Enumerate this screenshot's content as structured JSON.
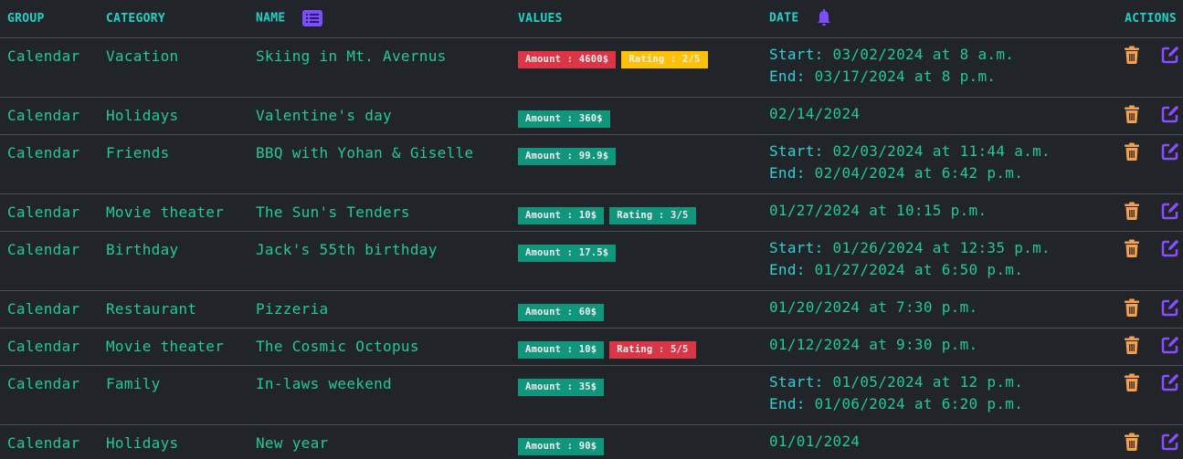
{
  "colors": {
    "background": "#212529",
    "header_text": "#20d3c9",
    "cell_text": "#20c997",
    "divider": "#4d5154",
    "badge_success": "#0f967c",
    "badge_danger": "#dc3545",
    "badge_warning": "#ffc107",
    "trash_icon": "#f5a04a",
    "edit_icon": "#8a4dff",
    "header_icon": "#7c4dff"
  },
  "header": {
    "group": "GROUP",
    "category": "CATEGORY",
    "name": "NAME",
    "name_icon": "list-icon",
    "values": "VALUES",
    "date": "DATE",
    "date_icon": "bell-icon",
    "actions": "ACTIONS"
  },
  "actions": {
    "delete_icon": "trash-icon",
    "edit_icon": "edit-icon"
  },
  "rows": [
    {
      "group": "Calendar",
      "category": "Vacation",
      "name": "Skiing in Mt. Avernus",
      "badges": [
        {
          "text": "Amount : 4600$",
          "variant": "danger"
        },
        {
          "text": "Rating : 2/5",
          "variant": "warning"
        }
      ],
      "date": {
        "start_label": "Start:",
        "start": "03/02/2024 at 8 a.m.",
        "end_label": "End:",
        "end": "03/17/2024 at 8 p.m."
      }
    },
    {
      "group": "Calendar",
      "category": "Holidays",
      "name": "Valentine's day",
      "badges": [
        {
          "text": "Amount : 360$",
          "variant": "success"
        }
      ],
      "date": {
        "single": "02/14/2024"
      }
    },
    {
      "group": "Calendar",
      "category": "Friends",
      "name": "BBQ with Yohan & Giselle",
      "badges": [
        {
          "text": "Amount : 99.9$",
          "variant": "success"
        }
      ],
      "date": {
        "start_label": "Start:",
        "start": "02/03/2024 at 11:44 a.m.",
        "end_label": "End:",
        "end": "02/04/2024 at 6:42 p.m."
      }
    },
    {
      "group": "Calendar",
      "category": "Movie theater",
      "name": "The Sun's Tenders",
      "badges": [
        {
          "text": "Amount : 10$",
          "variant": "success"
        },
        {
          "text": "Rating : 3/5",
          "variant": "success"
        }
      ],
      "date": {
        "single": "01/27/2024 at 10:15 p.m."
      }
    },
    {
      "group": "Calendar",
      "category": "Birthday",
      "name": "Jack's 55th birthday",
      "badges": [
        {
          "text": "Amount : 17.5$",
          "variant": "success"
        }
      ],
      "date": {
        "start_label": "Start:",
        "start": "01/26/2024 at 12:35 p.m.",
        "end_label": "End:",
        "end": "01/27/2024 at 6:50 p.m."
      }
    },
    {
      "group": "Calendar",
      "category": "Restaurant",
      "name": "Pizzeria",
      "badges": [
        {
          "text": "Amount : 60$",
          "variant": "success"
        }
      ],
      "date": {
        "single": "01/20/2024 at 7:30 p.m."
      }
    },
    {
      "group": "Calendar",
      "category": "Movie theater",
      "name": "The Cosmic Octopus",
      "badges": [
        {
          "text": "Amount : 10$",
          "variant": "success"
        },
        {
          "text": "Rating : 5/5",
          "variant": "danger"
        }
      ],
      "date": {
        "single": "01/12/2024 at 9:30 p.m."
      }
    },
    {
      "group": "Calendar",
      "category": "Family",
      "name": "In-laws weekend",
      "badges": [
        {
          "text": "Amount : 35$",
          "variant": "success"
        }
      ],
      "date": {
        "start_label": "Start:",
        "start": "01/05/2024 at 12 p.m.",
        "end_label": "End:",
        "end": "01/06/2024 at 6:20 p.m."
      }
    },
    {
      "group": "Calendar",
      "category": "Holidays",
      "name": "New year",
      "badges": [
        {
          "text": "Amount : 90$",
          "variant": "success"
        }
      ],
      "date": {
        "single": "01/01/2024"
      }
    }
  ]
}
